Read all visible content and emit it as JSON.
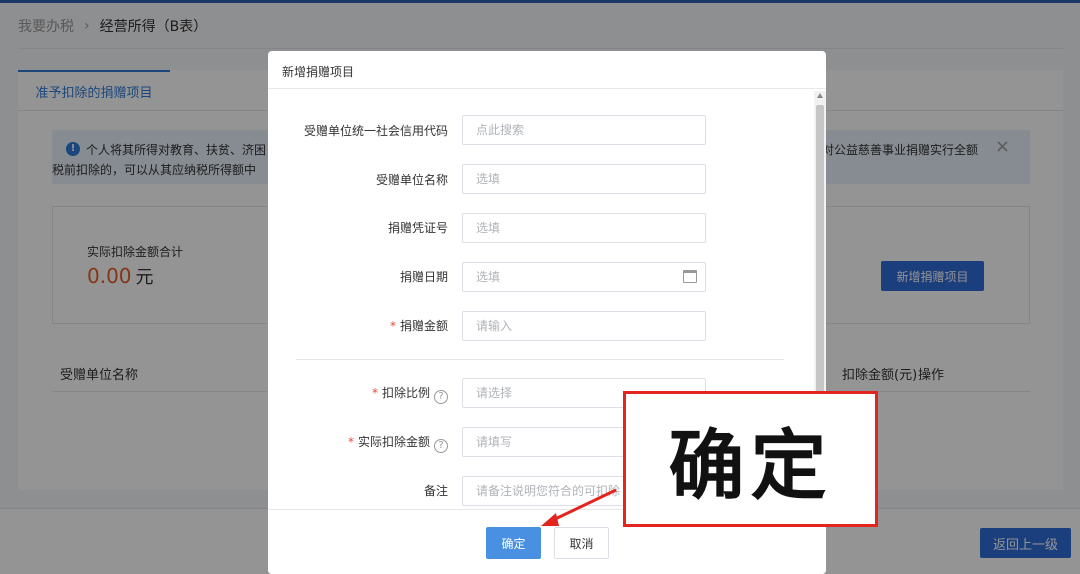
{
  "breadcrumb": {
    "parent": "我要办税",
    "current": "经营所得（B表）"
  },
  "tab": {
    "label": "准予扣除的捐赠项目"
  },
  "notice": {
    "line1": "个人将其所得对教育、扶贫、济困",
    "line1_right": "对公益慈善事业捐赠实行全额",
    "line2": "税前扣除的，可以从其应纳税所得额中"
  },
  "summary": {
    "label": "实际扣除金额合计",
    "value": "0.00",
    "unit": "元",
    "add_button": "新增捐赠项目"
  },
  "table": {
    "col_name": "受赠单位名称",
    "col_amount": "扣除金额(元)",
    "col_action": "操作"
  },
  "footer": {
    "back_button": "返回上一级"
  },
  "modal": {
    "title": "新增捐赠项目",
    "fields": {
      "credit_code": {
        "label": "受赠单位统一社会信用代码",
        "placeholder": "点此搜索"
      },
      "unit_name": {
        "label": "受赠单位名称",
        "placeholder": "选填"
      },
      "voucher_no": {
        "label": "捐赠凭证号",
        "placeholder": "选填"
      },
      "date": {
        "label": "捐赠日期",
        "placeholder": "选填"
      },
      "amount": {
        "label": "捐赠金额",
        "placeholder": "请输入"
      },
      "ratio": {
        "label": "扣除比例",
        "placeholder": "请选择"
      },
      "actual_amount": {
        "label": "实际扣除金额",
        "placeholder": "请填写"
      },
      "note": {
        "label": "备注",
        "placeholder": "请备注说明您符合的可扣除"
      }
    },
    "ok_button": "确定",
    "cancel_button": "取消"
  },
  "callout": {
    "text": "确定",
    "border_color": "#e2261f"
  },
  "colors": {
    "primary": "#2f6bd6",
    "accent": "#e35d26",
    "required": "#e34b3c"
  }
}
